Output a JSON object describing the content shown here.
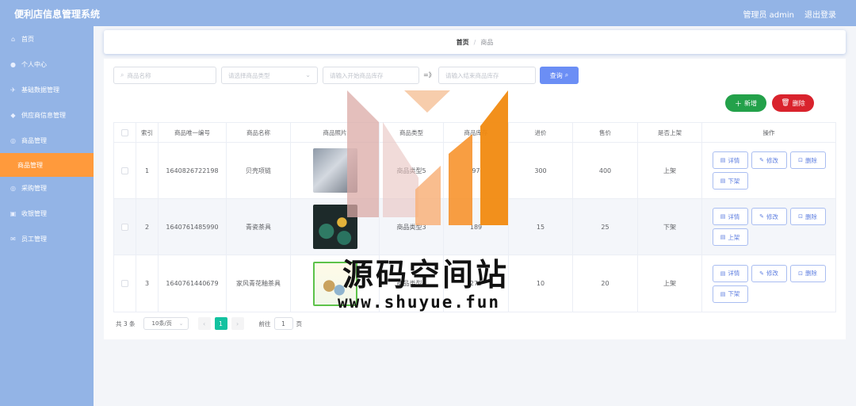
{
  "app": {
    "title": "便利店信息管理系统",
    "user": "管理员 admin",
    "logout": "退出登录"
  },
  "menu": [
    {
      "label": "首页",
      "icon": "home-icon",
      "glyph": "⌂"
    },
    {
      "label": "个人中心",
      "icon": "user-icon",
      "glyph": "●"
    },
    {
      "label": "基础数据管理",
      "icon": "plane-icon",
      "glyph": "✈"
    },
    {
      "label": "供应商信息管理",
      "icon": "shield-icon",
      "glyph": "◆"
    },
    {
      "label": "商品管理",
      "icon": "circle-icon",
      "glyph": "◎"
    },
    {
      "label": "商品管理",
      "icon": "",
      "glyph": ""
    },
    {
      "label": "采购管理",
      "icon": "circle-icon",
      "glyph": "◎"
    },
    {
      "label": "收银管理",
      "icon": "box-icon",
      "glyph": "▣"
    },
    {
      "label": "员工管理",
      "icon": "mail-icon",
      "glyph": "✉"
    }
  ],
  "breadcrumb": {
    "home": "首页",
    "sep": "/",
    "current": "商品"
  },
  "search": {
    "name_placeholder": "商品名称",
    "type_placeholder": "请选择商品类型",
    "stock_start_placeholder": "请输入开始商品库存",
    "range_separator": "=》",
    "stock_end_placeholder": "请输入结束商品库存",
    "query_label": "查询"
  },
  "actions": {
    "add_label": "新增",
    "delete_label": "删除"
  },
  "table": {
    "headers": [
      "",
      "索引",
      "商品唯一编号",
      "商品名称",
      "商品照片",
      "商品类型",
      "商品库存",
      "进价",
      "售价",
      "是否上架",
      "操作"
    ],
    "rows": [
      {
        "index": "1",
        "code": "1640826722198",
        "name": "贝壳项链",
        "type": "商品类型5",
        "stock": "97",
        "in_price": "300",
        "out_price": "400",
        "status": "上架",
        "toggle": "下架"
      },
      {
        "index": "2",
        "code": "1640761485990",
        "name": "青瓷茶具",
        "type": "商品类型3",
        "stock": "189",
        "in_price": "15",
        "out_price": "25",
        "status": "下架",
        "toggle": "上架"
      },
      {
        "index": "3",
        "code": "1640761440679",
        "name": "家风青花釉茶具",
        "type": "商品类型4",
        "stock": "279",
        "in_price": "10",
        "out_price": "20",
        "status": "上架",
        "toggle": "下架"
      }
    ],
    "row_actions": {
      "detail": "详情",
      "edit": "修改",
      "delete": "删除"
    }
  },
  "pagination": {
    "total": "共 3 条",
    "page_size": "10条/页",
    "prev": "‹",
    "current": "1",
    "next": "›",
    "goto": "前往",
    "goto_value": "1",
    "page_unit": "页"
  },
  "watermark": {
    "title": "源码空间站",
    "url": "www.shuyue.fun"
  },
  "colors": {
    "sidebar": "#93b4e6",
    "active": "#ff9a3c",
    "primary": "#6b8ef5",
    "success": "#23a14a",
    "danger": "#d9232d",
    "pager_active": "#13c2a0"
  }
}
